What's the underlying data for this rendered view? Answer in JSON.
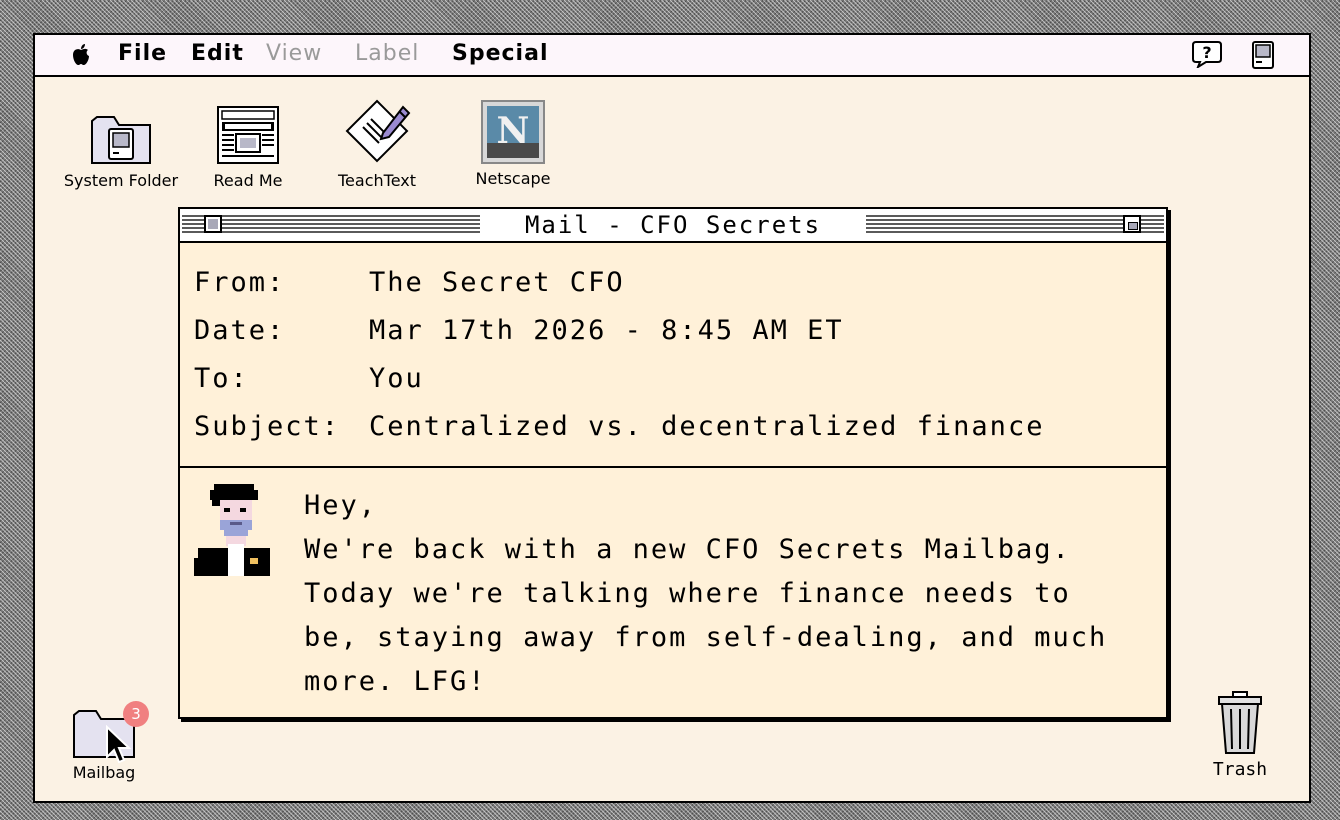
{
  "menubar": {
    "items": [
      {
        "label": "File",
        "enabled": true
      },
      {
        "label": "Edit",
        "enabled": true
      },
      {
        "label": "View",
        "enabled": false
      },
      {
        "label": "Label",
        "enabled": false
      },
      {
        "label": "Special",
        "enabled": true
      }
    ],
    "help_icon": "help-balloon-icon",
    "app_icon": "finder-mac-icon"
  },
  "desktop": {
    "icons": [
      {
        "label": "System Folder",
        "icon": "system-folder-icon"
      },
      {
        "label": "Read Me",
        "icon": "newspaper-icon"
      },
      {
        "label": "TeachText",
        "icon": "teachtext-icon"
      },
      {
        "label": "Netscape",
        "icon": "netscape-icon"
      }
    ],
    "mailbag": {
      "label": "Mailbag",
      "badge": "3",
      "icon": "folder-icon"
    },
    "trash": {
      "label": "Trash",
      "icon": "trash-icon"
    }
  },
  "window": {
    "title": "Mail - CFO Secrets",
    "headers": {
      "from_key": "From:",
      "from": "The Secret CFO",
      "date_key": "Date:",
      "date": "Mar 17th 2026 - 8:45 AM ET",
      "to_key": "To:",
      "to": "You",
      "subject_key": "Subject:",
      "subject": "Centralized vs. decentralized finance"
    },
    "body": [
      "Hey,",
      "We're back with a new CFO Secrets Mailbag.",
      "Today we're talking where finance needs to",
      "be, staying away from self-dealing, and much",
      "more. LFG!"
    ]
  },
  "colors": {
    "desktop": "#fbf2e4",
    "window_bg": "#fff1d9",
    "menubar_bg": "#fdf6fb",
    "badge": "#f08080",
    "disabled_menu": "#9a9a9a"
  }
}
